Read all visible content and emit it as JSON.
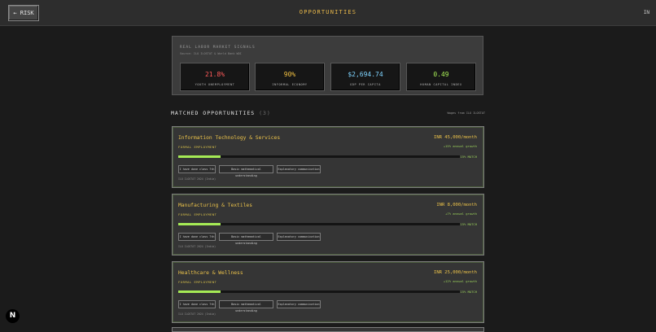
{
  "header": {
    "back_label": "← RISK",
    "title": "OPPORTUNITIES",
    "lang": "IN"
  },
  "signals": {
    "title": "REAL LABOR MARKET SIGNALS",
    "source": "Source: ILO ILOSTAT & World Bank WDI",
    "stats": [
      {
        "value": "21.8%",
        "label": "YOUTH UNEMPLOYMENT",
        "color": "#ff5a5a"
      },
      {
        "value": "90%",
        "label": "INFORMAL ECONOMY",
        "color": "#f4c242"
      },
      {
        "value": "$2,694.74",
        "label": "GDP PER CAPITA",
        "color": "#7fd4ff"
      },
      {
        "value": "0.49",
        "label": "HUMAN CAPITAL INDEX",
        "color": "#a5ea55"
      }
    ]
  },
  "matched": {
    "heading": "MATCHED OPPORTUNITIES",
    "count": "(3)",
    "wage_source": "Wages from ILO ILOSTAT"
  },
  "cards": [
    {
      "title": "Information Technology & Services",
      "sector": "FORMAL EMPLOYMENT",
      "wage": "INR 45,000/month",
      "growth": "+15% annual growth",
      "match_pct": 15,
      "match_label": "15% MATCH",
      "chips": [
        "I have done class 7th",
        "Basic mathematical understanding",
        "Explanatory communication"
      ],
      "cite": "ILO ILOSTAT 2024 (India)"
    },
    {
      "title": "Manufacturing & Textiles",
      "sector": "FORMAL EMPLOYMENT",
      "wage": "INR 8,000/month",
      "growth": "+7% annual growth",
      "match_pct": 15,
      "match_label": "15% MATCH",
      "chips": [
        "I have done class 7th",
        "Basic mathematical understanding",
        "Explanatory communication"
      ],
      "cite": "ILO ILOSTAT 2024 (India)"
    },
    {
      "title": "Healthcare & Wellness",
      "sector": "FORMAL EMPLOYMENT",
      "wage": "INR 25,000/month",
      "growth": "+12% annual growth",
      "match_pct": 15,
      "match_label": "15% MATCH",
      "chips": [
        "I have done class 7th",
        "Basic mathematical understanding",
        "Explanatory communication"
      ],
      "cite": "ILO ILOSTAT 2024 (India)"
    }
  ],
  "dev_badge": "N"
}
